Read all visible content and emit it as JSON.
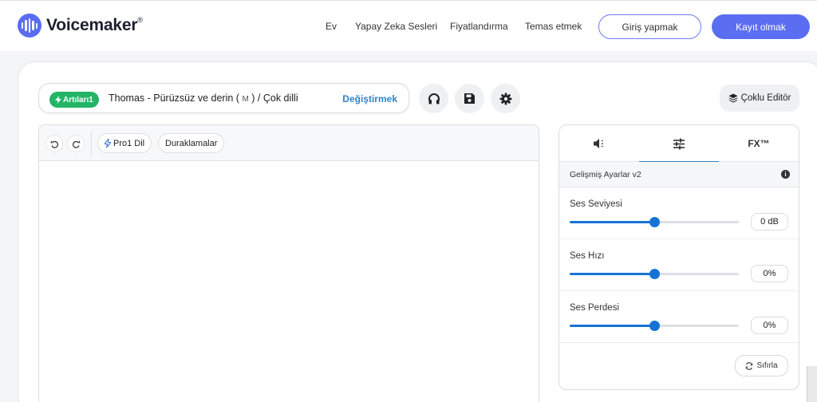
{
  "brand": {
    "name": "Voicemaker",
    "mark": "®"
  },
  "nav": {
    "links": [
      "Ev",
      "Yapay Zeka Sesleri",
      "Fiyatlandırma",
      "Temas etmek"
    ],
    "login_label": "Giriş yapmak",
    "register_label": "Kayıt olmak"
  },
  "voice": {
    "badge": "Artıları1",
    "name": "Thomas - Pürüzsüz ve derin (",
    "gender": "M",
    "suffix": ") / Çok dilli",
    "change_label": "Değiştirmek"
  },
  "toolbar": {
    "multi_editor_label": "Çoklu Editör",
    "icons": [
      "headphones-icon",
      "save-icon",
      "gear-icon"
    ]
  },
  "editor": {
    "pro_lang_label": "Pro1 Dil",
    "pauses_label": "Duraklamalar"
  },
  "panel": {
    "tabs": [
      "speaker-icon",
      "sliders-icon",
      "FX™"
    ],
    "active_tab": 1,
    "advanced_title": "Gelişmiş Ayarlar v2",
    "sliders": [
      {
        "label": "Ses Seviyesi",
        "value": "0 dB",
        "position": 0.5
      },
      {
        "label": "Ses Hızı",
        "value": "0%",
        "position": 0.5
      },
      {
        "label": "Ses Perdesi",
        "value": "0%",
        "position": 0.5
      }
    ],
    "reset_label": "Sıfırla"
  },
  "colors": {
    "accent": "#5b6ef1",
    "slider": "#1673d6",
    "badge": "#22b566",
    "link": "#2f86c9"
  }
}
